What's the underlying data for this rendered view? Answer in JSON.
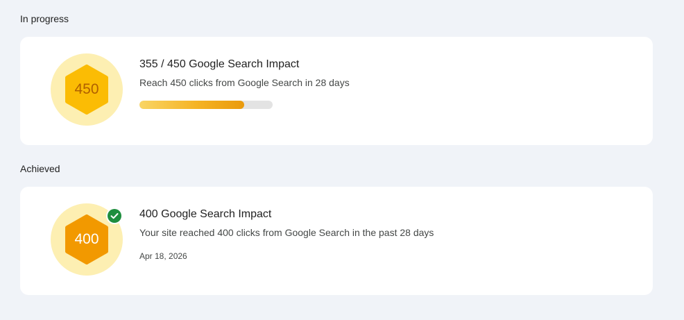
{
  "in_progress": {
    "heading": "In progress",
    "badge_value": "450",
    "title": "355 / 450 Google Search Impact",
    "description": "Reach 450 clicks from Google Search in 28 days",
    "progress_fraction": 0.7889,
    "colors": {
      "badge_bg": "#fdefb2",
      "hexagon": "#fbbc04",
      "badge_text": "#b06000",
      "progress_track": "#e3e3e3"
    }
  },
  "achieved": {
    "heading": "Achieved",
    "badge_value": "400",
    "title": "400 Google Search Impact",
    "description": "Your site reached 400 clicks from Google Search in the past 28 days",
    "date": "Apr 18, 2026",
    "check_icon": "check-circle-icon",
    "colors": {
      "badge_bg": "#fdefb2",
      "hexagon": "#f29900",
      "badge_text": "#ffffff",
      "check": "#1e8e3e"
    }
  },
  "page": {
    "background": "#f0f3f8",
    "card_background": "#ffffff"
  }
}
